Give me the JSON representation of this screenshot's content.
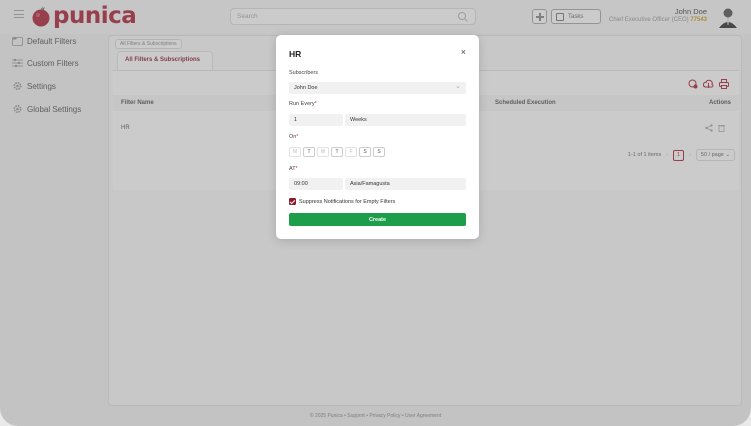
{
  "header": {
    "logo_text": "punica",
    "search_placeholder": "Search",
    "tasks_label": "Tasks",
    "user_name": "John Doe",
    "user_role": "Chief Executive Officer (CEO)",
    "user_id": "77543"
  },
  "sidebar": {
    "items": [
      {
        "label": "Default Filters",
        "icon": "folder-icon"
      },
      {
        "label": "Custom Filters",
        "icon": "sliders-icon"
      },
      {
        "label": "Settings",
        "icon": "gear-icon"
      },
      {
        "label": "Global Settings",
        "icon": "gear-icon"
      }
    ]
  },
  "main": {
    "breadcrumb": "All Filters & Subscriptions",
    "tab_label": "All Filters & Subscriptions",
    "table": {
      "headers": [
        "Filter Name",
        "Scheduled Execution",
        "Actions"
      ],
      "rows": [
        {
          "name": "HR"
        }
      ]
    },
    "pagination": {
      "summary": "1-1 of 1 items",
      "page": "1",
      "page_size": "50 / page"
    }
  },
  "footer": {
    "text": "© 2025 Punica • Support • Privacy Policy • User Agreement"
  },
  "modal": {
    "title": "HR",
    "close_glyph": "×",
    "subscribers_label": "Subscribers",
    "subscribers_value": "John Doe",
    "run_every_label": "Run Every",
    "run_every_value": "1",
    "run_every_unit": "Weeks",
    "on_label": "On",
    "days": [
      {
        "label": "M",
        "active": false
      },
      {
        "label": "T",
        "active": true
      },
      {
        "label": "W",
        "active": false
      },
      {
        "label": "T",
        "active": true
      },
      {
        "label": "F",
        "active": false
      },
      {
        "label": "S",
        "active": true
      },
      {
        "label": "S",
        "active": true
      }
    ],
    "at_label": "AT",
    "time_value": "09:00",
    "timezone_value": "Asia/Famagusta",
    "suppress_label": "Suppress Notifications for Empty Filters",
    "suppress_checked": true,
    "create_label": "Create",
    "required_marker": "*"
  },
  "colors": {
    "brand": "#b0243a",
    "primary_button": "#1e9e4a",
    "checkbox": "#8b1a2b"
  }
}
